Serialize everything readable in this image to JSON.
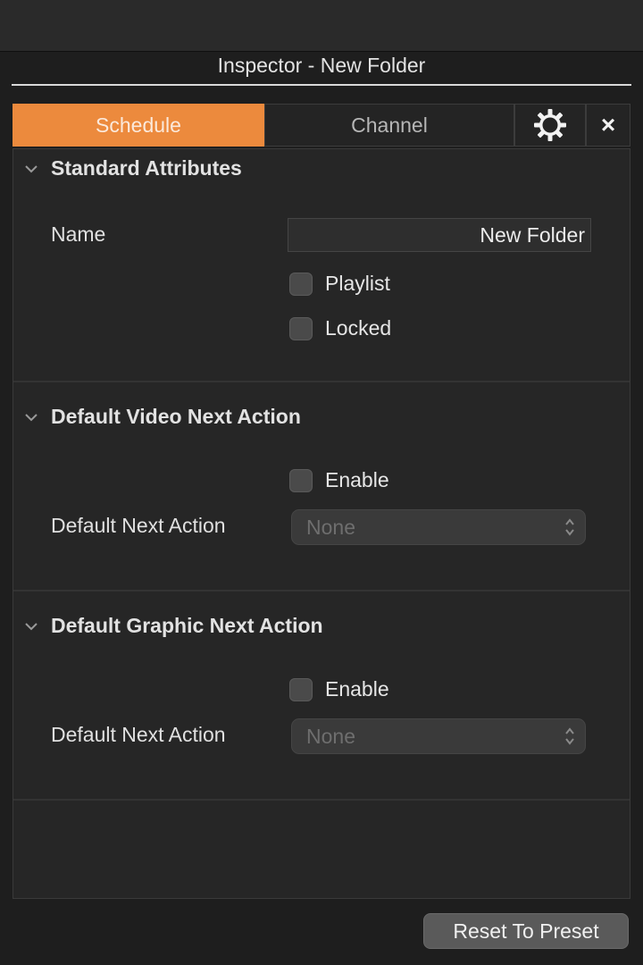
{
  "window": {
    "title": "Inspector - New Folder"
  },
  "tabs": {
    "schedule": "Schedule",
    "channel": "Channel",
    "gear_icon": "gear-icon",
    "close_symbol": "×"
  },
  "sections": [
    {
      "title": "Standard Attributes",
      "name_label": "Name",
      "name_value": "New Folder",
      "checkboxes": [
        {
          "label": "Playlist",
          "checked": false
        },
        {
          "label": "Locked",
          "checked": false
        }
      ]
    },
    {
      "title": "Default Video Next Action",
      "enable_label": "Enable",
      "enable_checked": false,
      "select_label": "Default Next Action",
      "select_value": "None"
    },
    {
      "title": "Default Graphic Next Action",
      "enable_label": "Enable",
      "enable_checked": false,
      "select_label": "Default Next Action",
      "select_value": "None"
    }
  ],
  "footer": {
    "reset_label": "Reset To Preset"
  },
  "colors": {
    "accent": "#ec8a3d",
    "background": "#1e1e1e",
    "panel": "#262626"
  }
}
